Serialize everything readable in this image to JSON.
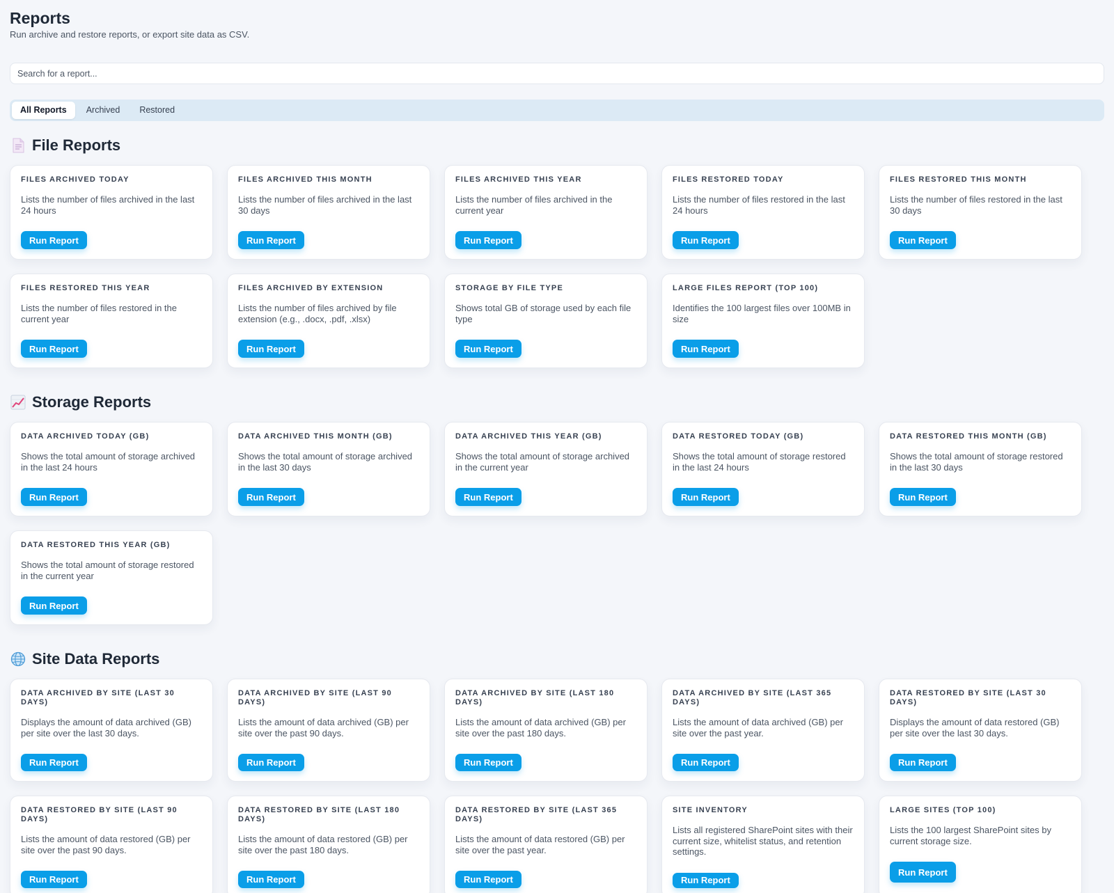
{
  "header": {
    "title": "Reports",
    "subtitle": "Run archive and restore reports, or export site data as CSV."
  },
  "search": {
    "placeholder": "Search for a report..."
  },
  "tabs": [
    {
      "label": "All Reports",
      "active": true
    },
    {
      "label": "Archived",
      "active": false
    },
    {
      "label": "Restored",
      "active": false
    }
  ],
  "button_label": "Run Report",
  "colors": {
    "accent": "#0a9ee8",
    "background": "#f4f6fa",
    "tab_bar": "#dceaf5"
  },
  "sections": [
    {
      "title": "File Reports",
      "icon": "document-icon",
      "cards": [
        {
          "title": "Files Archived Today",
          "desc": "Lists the number of files archived in the last 24 hours"
        },
        {
          "title": "Files Archived This Month",
          "desc": "Lists the number of files archived in the last 30 days"
        },
        {
          "title": "Files Archived This Year",
          "desc": "Lists the number of files archived in the current year"
        },
        {
          "title": "Files Restored Today",
          "desc": "Lists the number of files restored in the last 24 hours"
        },
        {
          "title": "Files Restored This Month",
          "desc": "Lists the number of files restored in the last 30 days"
        },
        {
          "title": "Files Restored This Year",
          "desc": "Lists the number of files restored in the current year"
        },
        {
          "title": "Files Archived By Extension",
          "desc": "Lists the number of files archived by file extension (e.g., .docx, .pdf, .xlsx)"
        },
        {
          "title": "Storage By File Type",
          "desc": "Shows total GB of storage used by each file type"
        },
        {
          "title": "Large Files Report (Top 100)",
          "desc": "Identifies the 100 largest files over 100MB in size"
        }
      ]
    },
    {
      "title": "Storage Reports",
      "icon": "chart-trend-icon",
      "cards": [
        {
          "title": "Data Archived Today (GB)",
          "desc": "Shows the total amount of storage archived in the last 24 hours"
        },
        {
          "title": "Data Archived This Month (GB)",
          "desc": "Shows the total amount of storage archived in the last 30 days"
        },
        {
          "title": "Data Archived This Year (GB)",
          "desc": "Shows the total amount of storage archived in the current year"
        },
        {
          "title": "Data Restored Today (GB)",
          "desc": "Shows the total amount of storage restored in the last 24 hours"
        },
        {
          "title": "Data Restored This Month (GB)",
          "desc": "Shows the total amount of storage restored in the last 30 days"
        },
        {
          "title": "Data Restored This Year (GB)",
          "desc": "Shows the total amount of storage restored in the current year"
        }
      ]
    },
    {
      "title": "Site Data Reports",
      "icon": "globe-icon",
      "cards": [
        {
          "title": "Data Archived By Site (Last 30 Days)",
          "desc": "Displays the amount of data archived (GB) per site over the last 30 days."
        },
        {
          "title": "Data Archived By Site (Last 90 Days)",
          "desc": "Lists the amount of data archived (GB) per site over the past 90 days."
        },
        {
          "title": "Data Archived By Site (Last 180 Days)",
          "desc": "Lists the amount of data archived (GB) per site over the past 180 days."
        },
        {
          "title": "Data Archived By Site (Last 365 Days)",
          "desc": "Lists the amount of data archived (GB) per site over the past year."
        },
        {
          "title": "Data Restored By Site (Last 30 Days)",
          "desc": "Displays the amount of data restored (GB) per site over the last 30 days."
        },
        {
          "title": "Data Restored By Site (Last 90 Days)",
          "desc": "Lists the amount of data restored (GB) per site over the past 90 days."
        },
        {
          "title": "Data Restored By Site (Last 180 Days)",
          "desc": "Lists the amount of data restored (GB) per site over the past 180 days."
        },
        {
          "title": "Data Restored By Site (Last 365 Days)",
          "desc": "Lists the amount of data restored (GB) per site over the past year."
        },
        {
          "title": "Site Inventory",
          "desc": "Lists all registered SharePoint sites with their current size, whitelist status, and retention settings."
        },
        {
          "title": "Large Sites (Top 100)",
          "desc": "Lists the 100 largest SharePoint sites by current storage size."
        }
      ]
    }
  ]
}
